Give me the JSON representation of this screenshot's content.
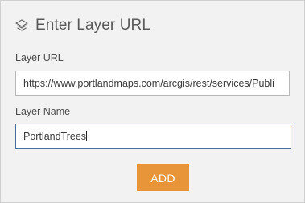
{
  "dialog": {
    "title": "Enter Layer URL",
    "title_icon": "layers-icon"
  },
  "form": {
    "url_label": "Layer URL",
    "url_value": "https://www.portlandmaps.com/arcgis/rest/services/Publi",
    "name_label": "Layer Name",
    "name_value": "PortlandTrees",
    "add_button_label": "ADD"
  },
  "colors": {
    "accent": "#e8953a",
    "focus_border": "#4a6f9c",
    "panel_bg": "#f2f2f2"
  }
}
